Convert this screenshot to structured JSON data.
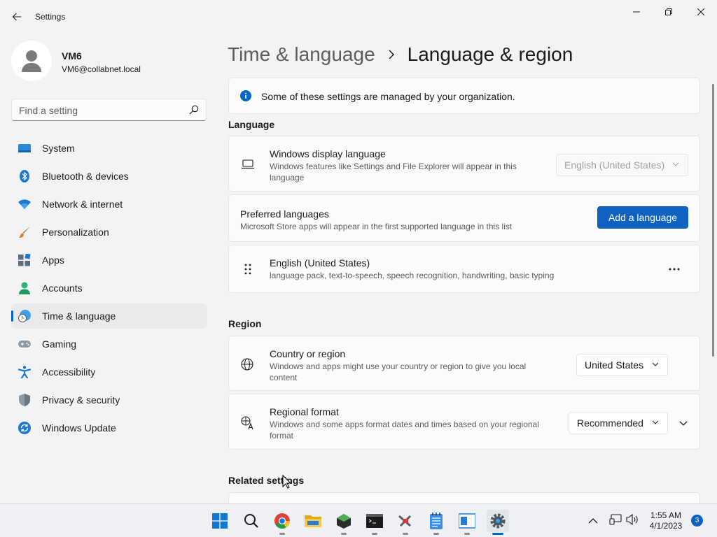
{
  "window": {
    "title": "Settings"
  },
  "profile": {
    "name": "VM6",
    "email": "VM6@collabnet.local"
  },
  "search": {
    "placeholder": "Find a setting"
  },
  "sidebar": {
    "items": [
      {
        "label": "System",
        "icon": "monitor-icon"
      },
      {
        "label": "Bluetooth & devices",
        "icon": "bluetooth-icon"
      },
      {
        "label": "Network & internet",
        "icon": "wifi-icon"
      },
      {
        "label": "Personalization",
        "icon": "brush-icon"
      },
      {
        "label": "Apps",
        "icon": "apps-icon"
      },
      {
        "label": "Accounts",
        "icon": "person-icon"
      },
      {
        "label": "Time & language",
        "icon": "clock-globe-icon",
        "active": true
      },
      {
        "label": "Gaming",
        "icon": "gamepad-icon"
      },
      {
        "label": "Accessibility",
        "icon": "accessibility-icon"
      },
      {
        "label": "Privacy & security",
        "icon": "shield-icon"
      },
      {
        "label": "Windows Update",
        "icon": "update-icon"
      }
    ]
  },
  "header": {
    "parent": "Time & language",
    "current": "Language & region"
  },
  "notice": {
    "text": "Some of these settings are managed by your organization."
  },
  "language": {
    "section_title": "Language",
    "display_language": {
      "title": "Windows display language",
      "description": "Windows features like Settings and File Explorer will appear in this language",
      "value": "English (United States)"
    },
    "preferred": {
      "title": "Preferred languages",
      "description": "Microsoft Store apps will appear in the first supported language in this list",
      "button": "Add a language"
    },
    "installed": {
      "title": "English (United States)",
      "description": "language pack, text-to-speech, speech recognition, handwriting, basic typing",
      "more": "..."
    }
  },
  "region": {
    "section_title": "Region",
    "country": {
      "title": "Country or region",
      "description": "Windows and apps might use your country or region to give you local content",
      "value": "United States"
    },
    "format": {
      "title": "Regional format",
      "description": "Windows and some apps format dates and times based on your regional format",
      "value": "Recommended"
    }
  },
  "related": {
    "section_title": "Related settings"
  },
  "taskbar": {
    "time": "1:55 AM",
    "date": "4/1/2023",
    "notification_count": "3"
  },
  "colors": {
    "accent": "#0067c0",
    "button": "#0f62c0"
  }
}
